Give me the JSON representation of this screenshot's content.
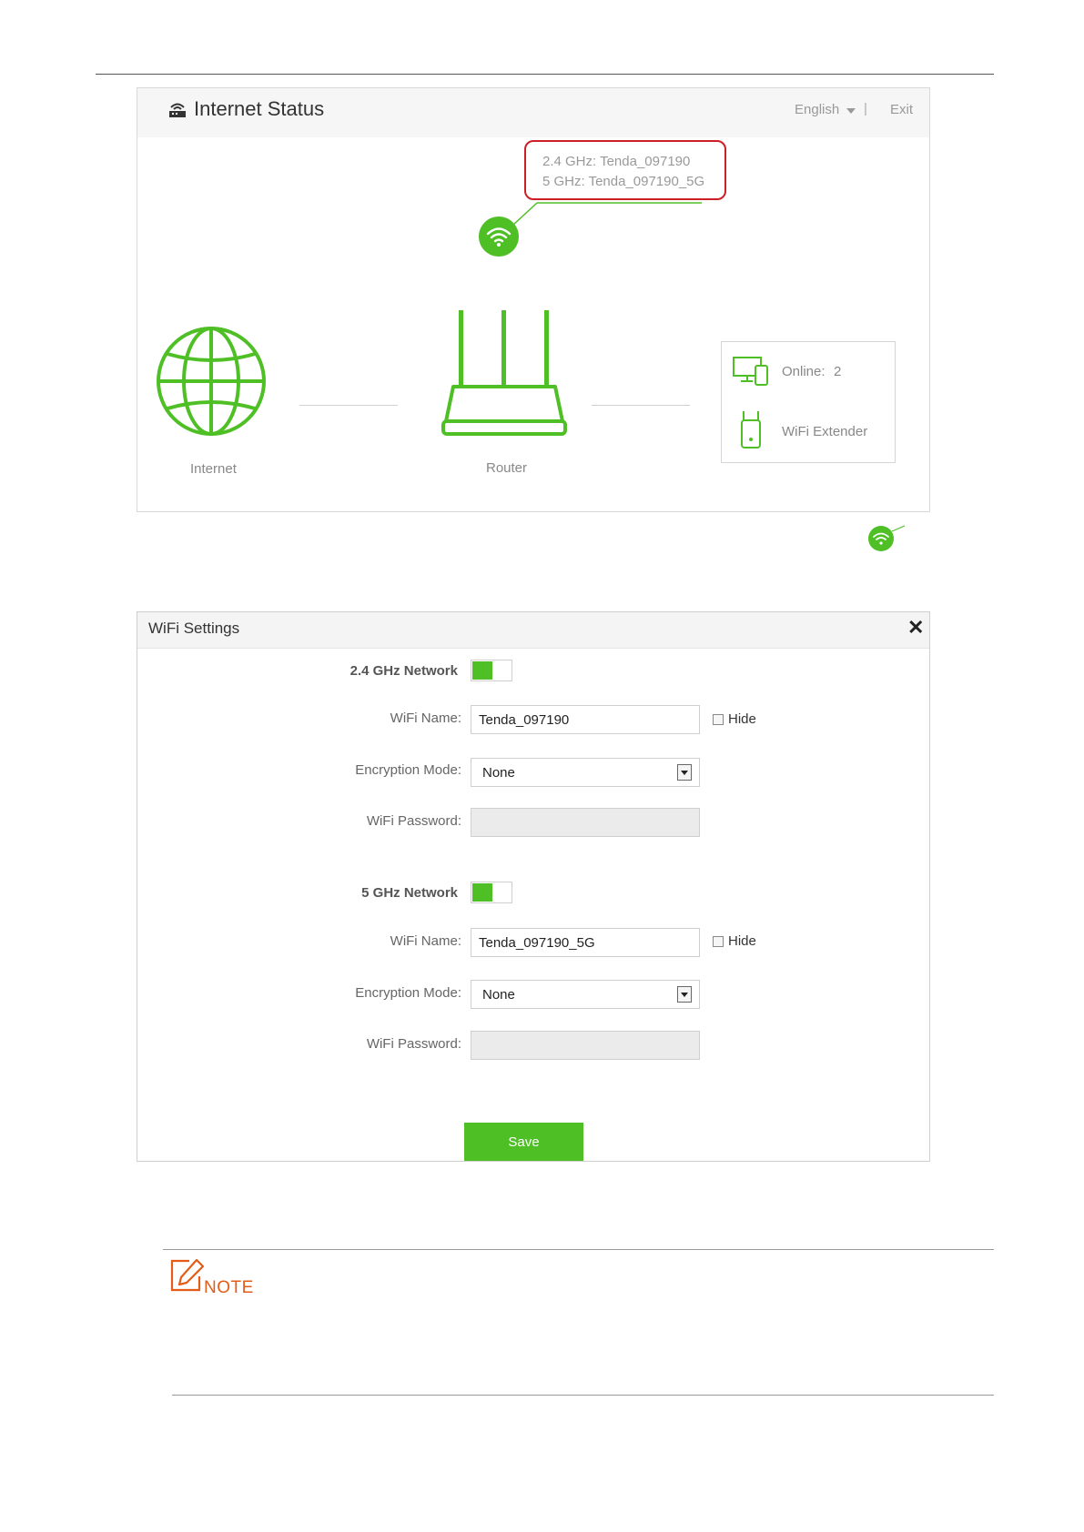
{
  "internet_status": {
    "title": "Internet Status",
    "language": "English",
    "separator": "|",
    "exit_label": "Exit",
    "ssid_24": "2.4 GHz: Tenda_097190",
    "ssid_5": "5 GHz: Tenda_097190_5G",
    "internet_label": "Internet",
    "router_label": "Router",
    "online_label": "Online:",
    "online_count": "2",
    "extender_label": "WiFi Extender"
  },
  "wifi_settings": {
    "title": "WiFi Settings",
    "close_glyph": "✕",
    "band_24": {
      "network_label": "2.4 GHz Network",
      "enabled": true,
      "name_label": "WiFi Name:",
      "name_value": "Tenda_097190",
      "hide_label": "Hide",
      "encryption_label": "Encryption Mode:",
      "encryption_value": "None",
      "password_label": "WiFi Password:",
      "password_value": ""
    },
    "band_5": {
      "network_label": "5 GHz Network",
      "enabled": true,
      "name_label": "WiFi Name:",
      "name_value": "Tenda_097190_5G",
      "hide_label": "Hide",
      "encryption_label": "Encryption Mode:",
      "encryption_value": "None",
      "password_label": "WiFi Password:",
      "password_value": ""
    },
    "save_label": "Save"
  },
  "note": {
    "label": "NOTE"
  },
  "colors": {
    "accent_green": "#4fbf26",
    "highlight_red": "#cc1f26",
    "note_orange": "#e35d18"
  }
}
